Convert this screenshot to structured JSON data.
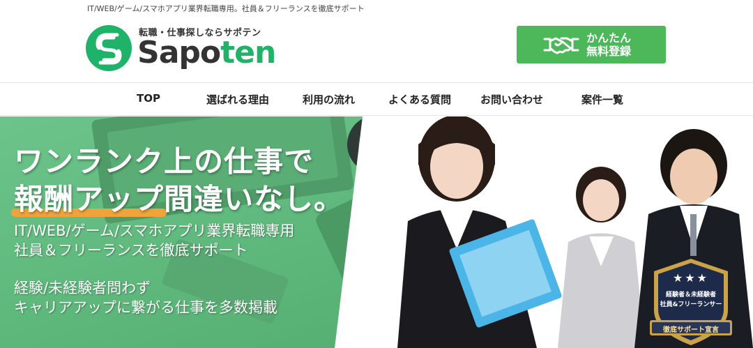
{
  "header": {
    "tagline": "IT/WEB/ゲーム/スマホアプリ業界転職専用。社員＆フリーランスを徹底サポート",
    "logo_sub": "転職・仕事探しならサポテン",
    "logo_name_part1": "Sapo",
    "logo_name_part2": "t",
    "logo_name_part3": "en",
    "register_line1": "かんたん",
    "register_line2": "無料登録"
  },
  "nav": {
    "items": [
      {
        "label": "TOP"
      },
      {
        "label": "選ばれる理由"
      },
      {
        "label": "利用の流れ"
      },
      {
        "label": "よくある質問"
      },
      {
        "label": "お問い合わせ"
      },
      {
        "label": "案件一覧"
      }
    ]
  },
  "hero": {
    "headline_line1": "ワンランク上の仕事で",
    "headline_line2_hl": "報酬アップ",
    "headline_line2_rest": "間違いなし。",
    "desc1_line1": "IT/WEB/ゲーム/スマホアプリ業界転職専用",
    "desc1_line2": "社員＆フリーランスを徹底サポート",
    "desc2_line1": "経験/未経験者問わず",
    "desc2_line2": "キャリアアップに繋がる仕事を多数掲載",
    "badge_line1": "経験者＆未経験者",
    "badge_line2": "社員&フリーランサー",
    "badge_ribbon": "徹底サポート宣言",
    "badge_stars": "★★★"
  },
  "colors": {
    "brand_green": "#1fb36a",
    "button_green": "#4cb85a",
    "hero_green": "#5fb57a",
    "highlight_orange": "#f0a33a",
    "badge_navy": "#1e2a4a",
    "badge_gold": "#c9a24a"
  },
  "icons": {
    "logo": "sapoten-s-logo-icon",
    "register": "handshake-icon"
  }
}
